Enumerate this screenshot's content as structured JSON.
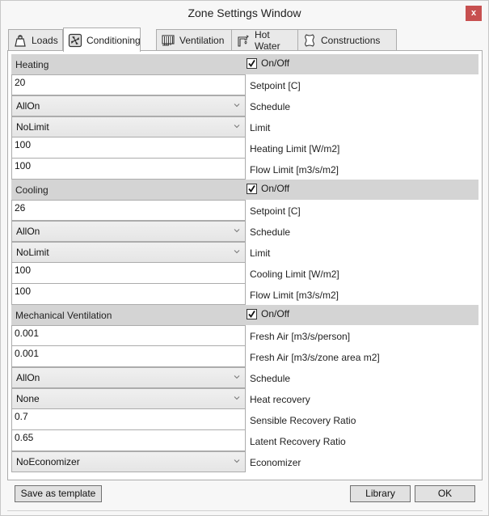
{
  "window": {
    "title": "Zone Settings Window",
    "close_label": "x"
  },
  "tabs": [
    {
      "label": "Loads",
      "icon": "weight-icon",
      "active": false
    },
    {
      "label": "Conditioning",
      "icon": "fan-icon",
      "active": true
    },
    {
      "label": "Ventilation",
      "icon": "radiator-icon",
      "active": false
    },
    {
      "label": "Hot Water",
      "icon": "faucet-icon",
      "active": false
    },
    {
      "label": "Constructions",
      "icon": "hide-icon",
      "active": false
    }
  ],
  "heating": {
    "title": "Heating",
    "onoff_label": "On/Off",
    "onoff_checked": true,
    "setpoint": {
      "value": "20",
      "label": "Setpoint [C]"
    },
    "schedule": {
      "value": "AllOn",
      "label": "Schedule"
    },
    "limit": {
      "value": "NoLimit",
      "label": "Limit"
    },
    "heating_limit": {
      "value": "100",
      "label": "Heating Limit [W/m2]"
    },
    "flow_limit": {
      "value": "100",
      "label": "Flow Limit [m3/s/m2]"
    }
  },
  "cooling": {
    "title": "Cooling",
    "onoff_label": "On/Off",
    "onoff_checked": true,
    "setpoint": {
      "value": "26",
      "label": "Setpoint [C]"
    },
    "schedule": {
      "value": "AllOn",
      "label": "Schedule"
    },
    "limit": {
      "value": "NoLimit",
      "label": "Limit"
    },
    "cooling_limit": {
      "value": "100",
      "label": "Cooling Limit [W/m2]"
    },
    "flow_limit": {
      "value": "100",
      "label": "Flow Limit [m3/s/m2]"
    }
  },
  "mech_vent": {
    "title": "Mechanical Ventilation",
    "onoff_label": "On/Off",
    "onoff_checked": true,
    "fresh_air_person": {
      "value": "0.001",
      "label": "Fresh Air [m3/s/person]"
    },
    "fresh_air_area": {
      "value": "0.001",
      "label": "Fresh Air [m3/s/zone area m2]"
    },
    "schedule": {
      "value": "AllOn",
      "label": "Schedule"
    },
    "heat_recovery": {
      "value": "None",
      "label": "Heat recovery"
    },
    "sensible_ratio": {
      "value": "0.7",
      "label": "Sensible Recovery Ratio"
    },
    "latent_ratio": {
      "value": "0.65",
      "label": "Latent Recovery Ratio"
    },
    "economizer": {
      "value": "NoEconomizer",
      "label": "Economizer"
    }
  },
  "footer": {
    "save_template_label": "Save as template",
    "library_label": "Library",
    "ok_label": "OK"
  }
}
